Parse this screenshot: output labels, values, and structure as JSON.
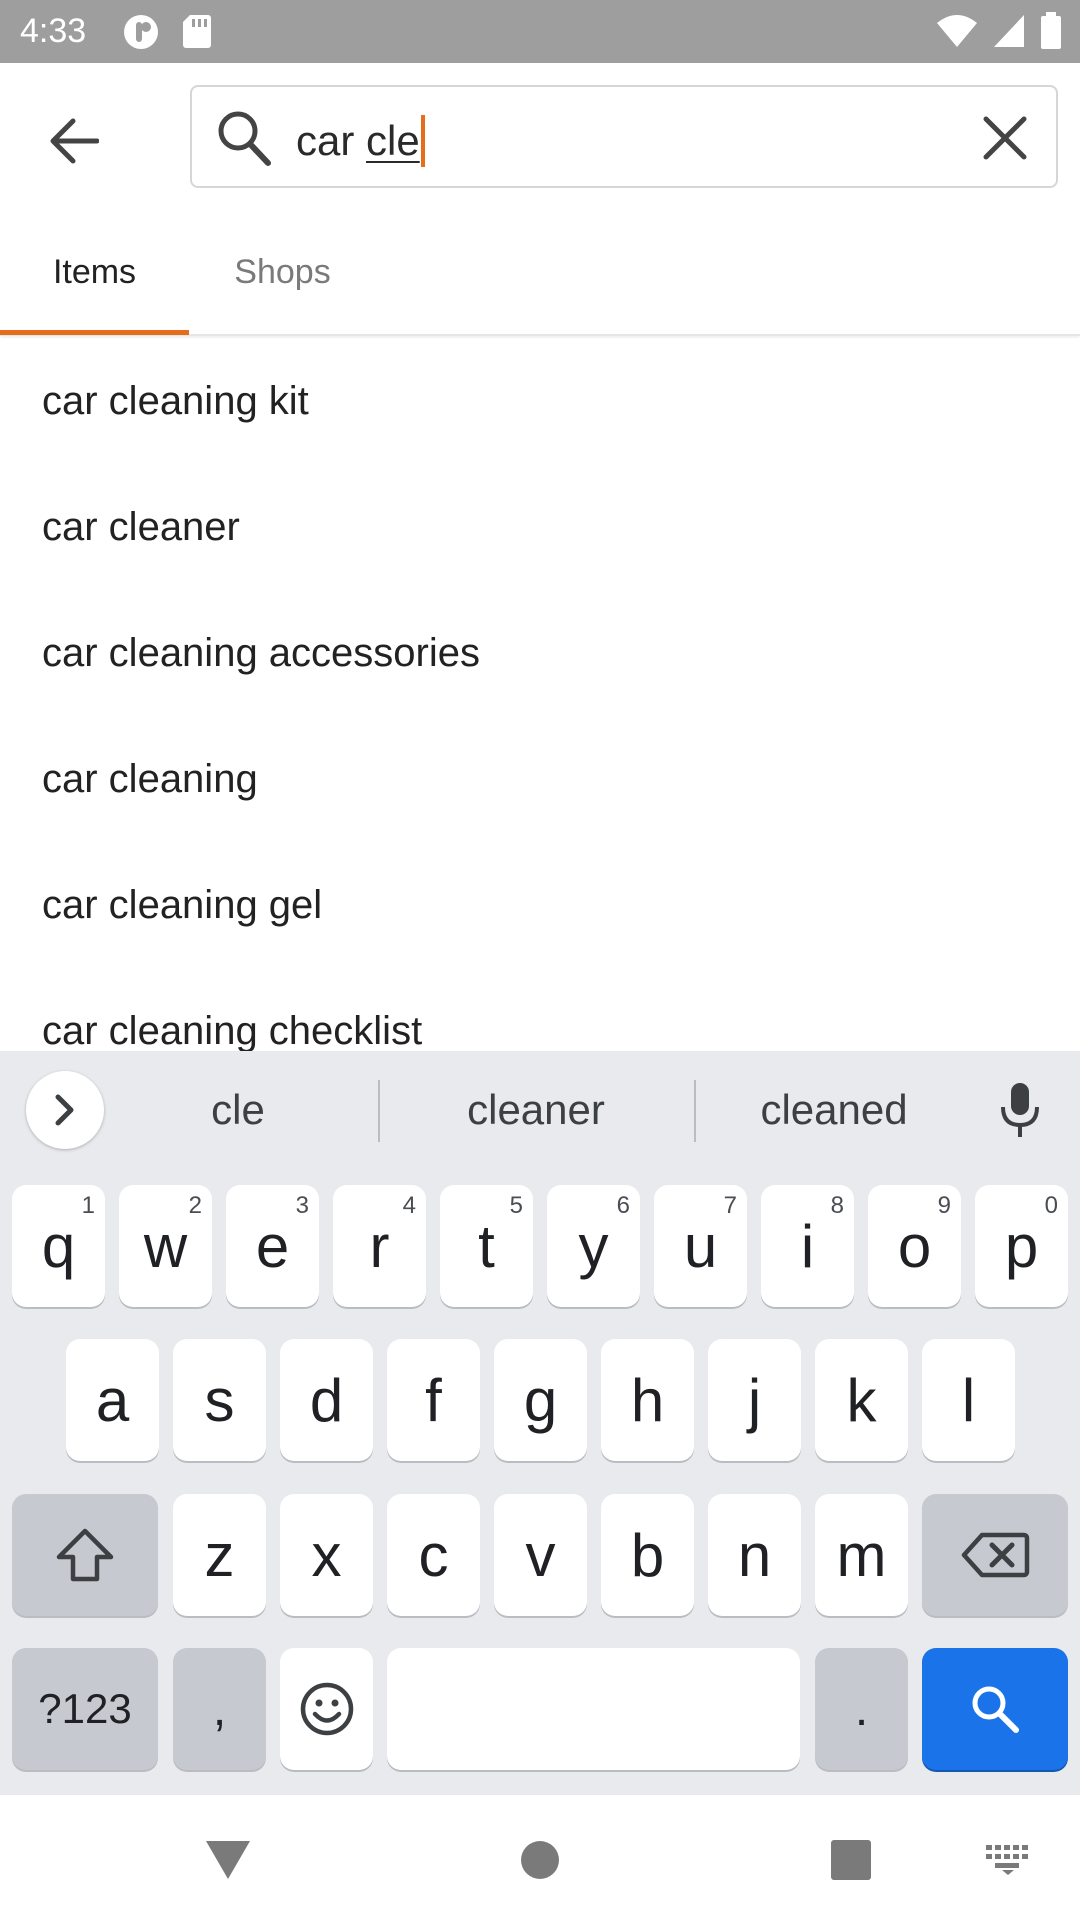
{
  "status_bar": {
    "time": "4:33",
    "icons": [
      "notification-app-icon",
      "sd-card-icon",
      "wifi-icon",
      "cell-signal-icon",
      "battery-icon"
    ]
  },
  "search": {
    "query_prefix": "car ",
    "query_composing": "cle",
    "back_icon": "arrow-left-icon",
    "search_icon": "magnifier-icon",
    "clear_icon": "close-icon",
    "accent_color": "#e66e1a"
  },
  "tabs": [
    {
      "label": "Items",
      "selected": true
    },
    {
      "label": "Shops",
      "selected": false
    }
  ],
  "suggestions": [
    "car cleaning kit",
    "car cleaner",
    "car cleaning accessories",
    "car cleaning",
    "car cleaning gel",
    "car cleaning checklist"
  ],
  "keyboard": {
    "suggestion_words": [
      "cle",
      "cleaner",
      "cleaned"
    ],
    "row1": [
      {
        "key": "q",
        "hint": "1"
      },
      {
        "key": "w",
        "hint": "2"
      },
      {
        "key": "e",
        "hint": "3"
      },
      {
        "key": "r",
        "hint": "4"
      },
      {
        "key": "t",
        "hint": "5"
      },
      {
        "key": "y",
        "hint": "6"
      },
      {
        "key": "u",
        "hint": "7"
      },
      {
        "key": "i",
        "hint": "8"
      },
      {
        "key": "o",
        "hint": "9"
      },
      {
        "key": "p",
        "hint": "0"
      }
    ],
    "row2": [
      "a",
      "s",
      "d",
      "f",
      "g",
      "h",
      "j",
      "k",
      "l"
    ],
    "row3": [
      "z",
      "x",
      "c",
      "v",
      "b",
      "n",
      "m"
    ],
    "symbols_label": "?123",
    "comma": ",",
    "period": ".",
    "search_key_color": "#1a73e8"
  },
  "nav_bar": {
    "icons": [
      "back-triangle-icon",
      "home-circle-icon",
      "recents-square-icon",
      "keyboard-switch-icon"
    ]
  }
}
